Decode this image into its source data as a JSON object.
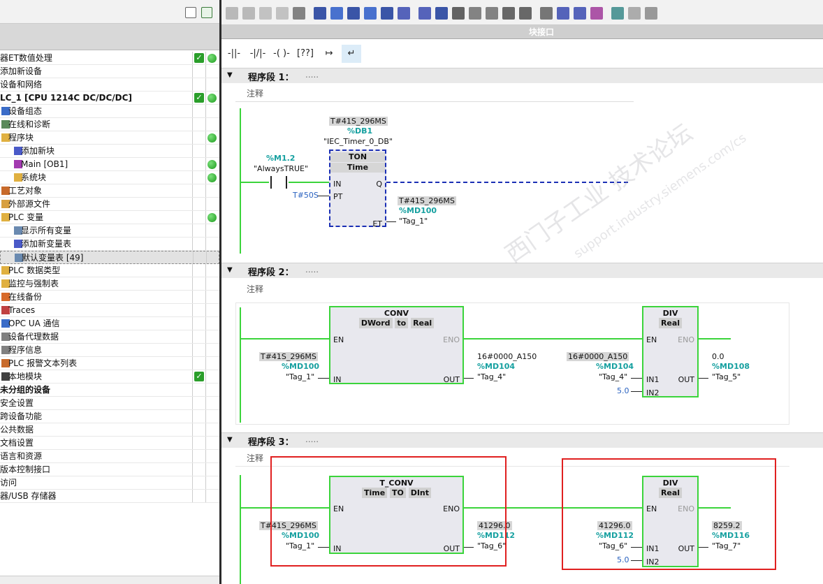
{
  "tree": [
    {
      "label": "器ET数值处理",
      "indent": 0,
      "check": true,
      "dot": true,
      "icon": "none"
    },
    {
      "label": "添加新设备",
      "indent": 0,
      "icon": "none"
    },
    {
      "label": "设备和网络",
      "indent": 0,
      "icon": "none"
    },
    {
      "label": "LC_1 [CPU 1214C DC/DC/DC]",
      "indent": 0,
      "bold": true,
      "check": true,
      "dot": true,
      "icon": "none"
    },
    {
      "label": "设备组态",
      "indent": 12,
      "icon": "device-config-icon"
    },
    {
      "label": "在线和诊断",
      "indent": 12,
      "icon": "online-diagnostics-icon"
    },
    {
      "label": "程序块",
      "indent": 12,
      "dot": true,
      "icon": "folder-icon"
    },
    {
      "label": "添加新块",
      "indent": 30,
      "icon": "add-block-icon"
    },
    {
      "label": "Main [OB1]",
      "indent": 30,
      "dot": true,
      "icon": "ob-block-icon"
    },
    {
      "label": "系统块",
      "indent": 30,
      "dot": true,
      "icon": "folder-icon"
    },
    {
      "label": "工艺对象",
      "indent": 12,
      "icon": "technology-object-icon"
    },
    {
      "label": "外部源文件",
      "indent": 12,
      "icon": "external-source-icon"
    },
    {
      "label": "PLC 变量",
      "indent": 12,
      "dot": true,
      "icon": "folder-icon"
    },
    {
      "label": "显示所有变量",
      "indent": 30,
      "icon": "show-tags-icon"
    },
    {
      "label": "添加新变量表",
      "indent": 30,
      "icon": "add-tag-table-icon"
    },
    {
      "label": "默认变量表 [49]",
      "indent": 30,
      "selected": true,
      "icon": "tag-table-icon"
    },
    {
      "label": "PLC 数据类型",
      "indent": 12,
      "icon": "folder-icon"
    },
    {
      "label": "监控与强制表",
      "indent": 12,
      "icon": "folder-icon"
    },
    {
      "label": "在线备份",
      "indent": 12,
      "icon": "backup-icon"
    },
    {
      "label": "Traces",
      "indent": 12,
      "icon": "trace-icon"
    },
    {
      "label": "OPC UA 通信",
      "indent": 12,
      "icon": "opc-ua-icon"
    },
    {
      "label": "设备代理数据",
      "indent": 12,
      "icon": "proxy-data-icon"
    },
    {
      "label": "程序信息",
      "indent": 12,
      "icon": "program-info-icon"
    },
    {
      "label": "PLC 报警文本列表",
      "indent": 12,
      "icon": "alarm-text-icon"
    },
    {
      "label": "本地模块",
      "indent": 12,
      "check": true,
      "icon": "local-module-icon"
    },
    {
      "label": "未分组的设备",
      "indent": 0,
      "bold": true,
      "icon": "none"
    },
    {
      "label": "安全设置",
      "indent": 0,
      "icon": "none"
    },
    {
      "label": "跨设备功能",
      "indent": 0,
      "icon": "none"
    },
    {
      "label": "公共数据",
      "indent": 0,
      "icon": "none"
    },
    {
      "label": "文档设置",
      "indent": 0,
      "icon": "none"
    },
    {
      "label": "语言和资源",
      "indent": 0,
      "icon": "none"
    },
    {
      "label": "版本控制接口",
      "indent": 0,
      "icon": "none"
    },
    {
      "label": "访问",
      "indent": 0,
      "icon": "none"
    },
    {
      "label": "器/USB 存储器",
      "indent": 0,
      "icon": "none"
    }
  ],
  "editor": {
    "interface_label": "块接口",
    "ladder_buttons": [
      "-||-",
      "-|/|-",
      "-( )-",
      "[??]",
      "↦",
      "↵"
    ]
  },
  "segments": [
    {
      "title": "程序段 1：",
      "dots": ".....",
      "comment": "注释"
    },
    {
      "title": "程序段 2：",
      "dots": ".....",
      "comment": "注释"
    },
    {
      "title": "程序段 3：",
      "dots": ".....",
      "comment": "注释"
    }
  ],
  "net1": {
    "db_value": "T#41S_296MS",
    "db_addr": "%DB1",
    "db_name": "\"IEC_Timer_0_DB\"",
    "contact_addr": "%M1.2",
    "contact_name": "\"AlwaysTRUE\"",
    "block_title": "TON",
    "block_type": "Time",
    "pin_in": "IN",
    "pin_pt": "PT",
    "pin_q": "Q",
    "pin_et": "ET",
    "pt_value": "T#50S",
    "et_value": "T#41S_296MS",
    "et_addr": "%MD100",
    "et_name": "\"Tag_1\""
  },
  "net2": {
    "b1_title": "CONV",
    "b1_from": "DWord",
    "b1_to_word": "to",
    "b1_to": "Real",
    "b1_en": "EN",
    "b1_eno": "ENO",
    "b1_in": "IN",
    "b1_out": "OUT",
    "b1_in_value": "T#41S_296MS",
    "b1_in_addr": "%MD100",
    "b1_in_name": "\"Tag_1\"",
    "b1_out_value": "16#0000_A150",
    "b1_out_addr": "%MD104",
    "b1_out_name": "\"Tag_4\"",
    "b2_title": "DIV",
    "b2_type": "Real",
    "b2_en": "EN",
    "b2_eno": "ENO",
    "b2_in1": "IN1",
    "b2_in2": "IN2",
    "b2_out": "OUT",
    "b2_in1_value": "16#0000_A150",
    "b2_in1_addr": "%MD104",
    "b2_in1_name": "\"Tag_4\"",
    "b2_in2_value": "5.0",
    "b2_out_value": "0.0",
    "b2_out_addr": "%MD108",
    "b2_out_name": "\"Tag_5\""
  },
  "net3": {
    "b1_title": "T_CONV",
    "b1_from": "Time",
    "b1_to_word": "TO",
    "b1_to": "DInt",
    "b1_en": "EN",
    "b1_eno": "ENO",
    "b1_in": "IN",
    "b1_out": "OUT",
    "b1_in_value": "T#41S_296MS",
    "b1_in_addr": "%MD100",
    "b1_in_name": "\"Tag_1\"",
    "b1_out_value": "41296.0",
    "b1_out_addr": "%MD112",
    "b1_out_name": "\"Tag_6\"",
    "b2_title": "DIV",
    "b2_type": "Real",
    "b2_en": "EN",
    "b2_eno": "ENO",
    "b2_in1": "IN1",
    "b2_in2": "IN2",
    "b2_out": "OUT",
    "b2_in1_value": "41296.0",
    "b2_in1_addr": "%MD112",
    "b2_in1_name": "\"Tag_6\"",
    "b2_in2_value": "5.0",
    "b2_out_value": "8259.2",
    "b2_out_addr": "%MD116",
    "b2_out_name": "\"Tag_7\""
  },
  "watermark": {
    "line1": "西门子工业   技术论坛",
    "line2": "support.industry.siemens.com/cs"
  },
  "colors": {
    "rail": "#3bd43b",
    "addr": "#16a0a0",
    "highlight": "#e02020",
    "selected_block": "#1b2fb5"
  }
}
